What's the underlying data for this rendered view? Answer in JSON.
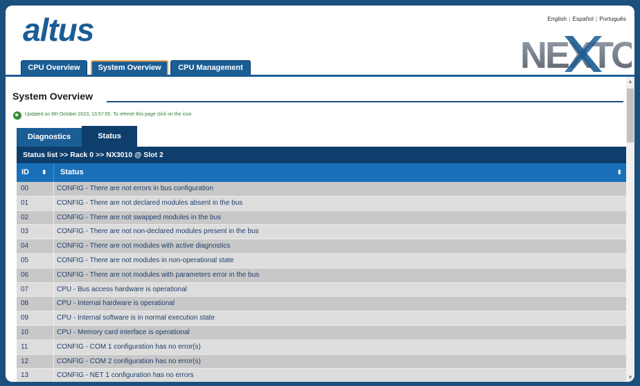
{
  "header": {
    "logo_text": "altus",
    "brand_text": "NEXTO",
    "languages": [
      "English",
      "Español",
      "Português"
    ],
    "brand_color": "#1b5d95",
    "accent_color": "#e8a24d"
  },
  "top_nav": {
    "tabs": [
      {
        "label": "CPU Overview",
        "active": false
      },
      {
        "label": "System Overview",
        "active": true
      },
      {
        "label": "CPU Management",
        "active": false
      }
    ]
  },
  "page": {
    "title": "System Overview",
    "updated_text": "Updated on 6th October 2023, 13:57:55. To refresh this page click on the icon."
  },
  "sub_tabs": [
    {
      "label": "Diagnostics",
      "active": false
    },
    {
      "label": "Status",
      "active": true
    }
  ],
  "breadcrumb": "Status list >> Rack 0 >> NX3010 @ Slot 2",
  "table": {
    "columns": [
      "ID",
      "Status"
    ],
    "rows": [
      {
        "id": "00",
        "status": "CONFIG - There are not errors in bus configuration"
      },
      {
        "id": "01",
        "status": "CONFIG - There are not declared modules absent in the bus"
      },
      {
        "id": "02",
        "status": "CONFIG - There are not swapped modules in the bus"
      },
      {
        "id": "03",
        "status": "CONFIG - There are not non-declared modules present in the bus"
      },
      {
        "id": "04",
        "status": "CONFIG - There are not modules with active diagnostics"
      },
      {
        "id": "05",
        "status": "CONFIG - There are not modules in non-operational state"
      },
      {
        "id": "06",
        "status": "CONFIG - There are not modules with parameters error in the bus"
      },
      {
        "id": "07",
        "status": "CPU - Bus access hardware is operational"
      },
      {
        "id": "08",
        "status": "CPU - Internal hardware is operational"
      },
      {
        "id": "09",
        "status": "CPU - Internal software is in normal execution state"
      },
      {
        "id": "10",
        "status": "CPU - Memory card interface is operational"
      },
      {
        "id": "11",
        "status": "CONFIG - COM 1 configuration has no error(s)"
      },
      {
        "id": "12",
        "status": "CONFIG - COM 2 configuration has no error(s)"
      },
      {
        "id": "13",
        "status": "CONFIG - NET 1 configuration has no errors"
      }
    ]
  },
  "icons": {
    "refresh": "refresh-icon",
    "sort": "sort-icon",
    "scroll_up": "chevron-up-icon",
    "scroll_down": "chevron-down-icon"
  }
}
